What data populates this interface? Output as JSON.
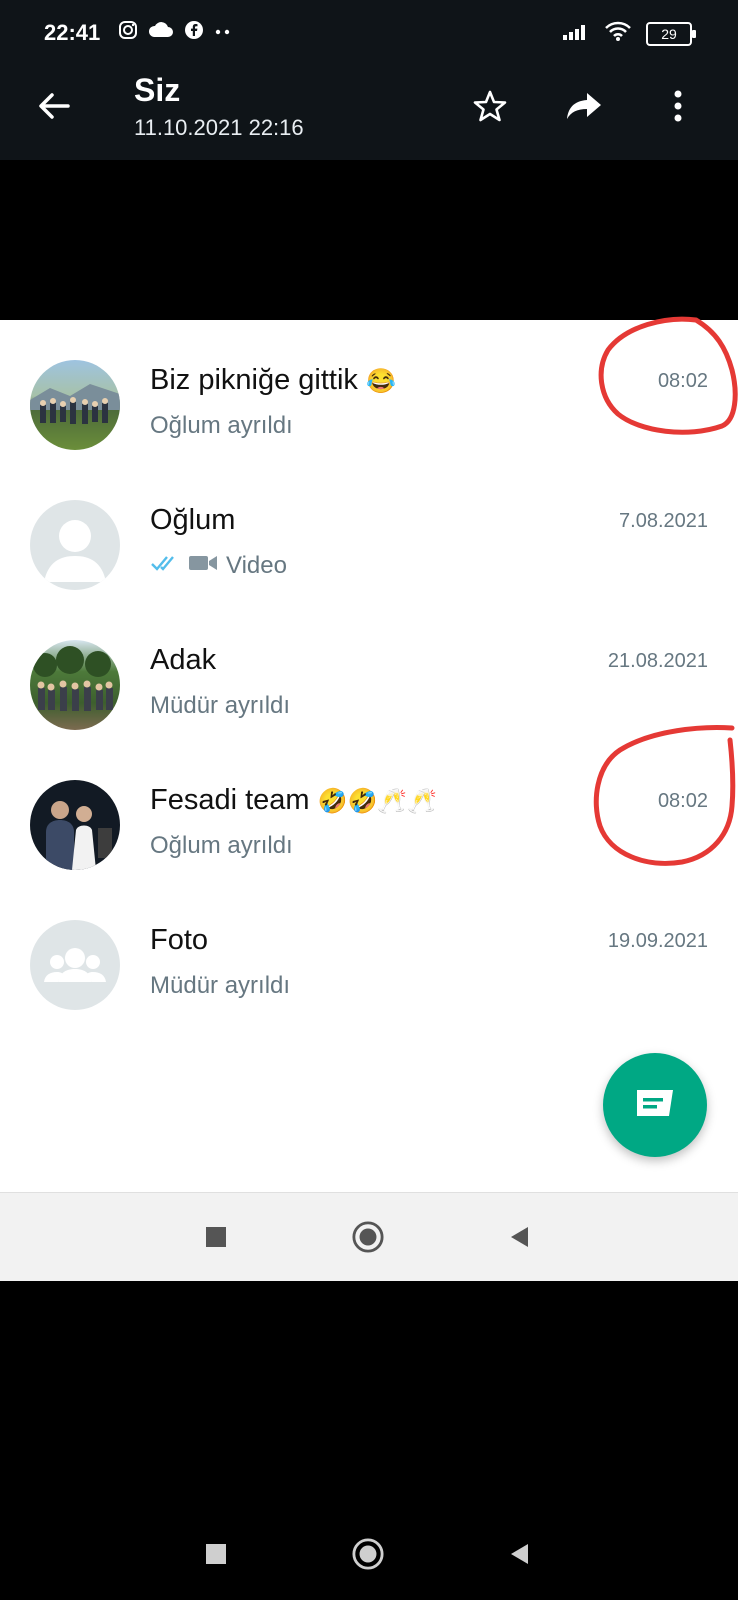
{
  "status_bar": {
    "time": "22:41",
    "icons": [
      "instagram-icon",
      "cloud-icon",
      "facebook-icon",
      "more-dots-icon",
      "signal-icon",
      "wifi-icon",
      "battery-icon"
    ],
    "battery_level": "29"
  },
  "header": {
    "title": "Siz",
    "subtitle": "11.10.2021 22:16",
    "icons": [
      "back-arrow-icon",
      "star-icon",
      "share-icon",
      "overflow-menu-icon"
    ]
  },
  "chats": [
    {
      "name": "Biz pikniğe gittik",
      "emoji": "😂",
      "last_message": "Oğlum ayrıldı",
      "time": "08:02",
      "avatar": "group-photo",
      "circled": true
    },
    {
      "name": "Oğlum",
      "last_message": "Video",
      "time": "7.08.2021",
      "avatar": "default-person",
      "ticks": "read-ticks-icon",
      "media": "video-icon"
    },
    {
      "name": "Adak",
      "last_message": "Müdür ayrıldı",
      "time": "21.08.2021",
      "avatar": "group-photo"
    },
    {
      "name": "Fesadi team",
      "emoji": "🤣🤣🥂🥂",
      "last_message": "Oğlum ayrıldı",
      "time": "08:02",
      "avatar": "photo",
      "circled": true
    },
    {
      "name": "Foto",
      "last_message": "Müdür ayrıldı",
      "time": "19.09.2021",
      "avatar": "default-group"
    }
  ],
  "fab": {
    "icon": "new-chat-icon",
    "color": "#00a884"
  },
  "colors": {
    "accent": "#00a884",
    "annotation": "#e53935",
    "header_bg": "#0f1418"
  },
  "nav": {
    "icons": [
      "recent-apps-icon",
      "home-icon",
      "back-triangle-icon"
    ]
  }
}
